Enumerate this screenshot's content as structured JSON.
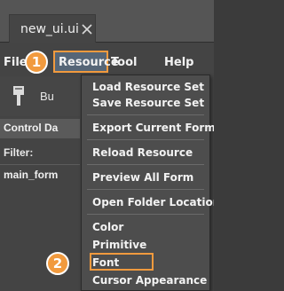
{
  "tab": {
    "title": "new_ui.ui",
    "close_icon": "close-icon"
  },
  "menubar": {
    "file": "File",
    "resource": "Resource",
    "tool": "Tool",
    "help": "Help"
  },
  "toolbar": {
    "label": "Bu",
    "icon": "brush-icon"
  },
  "left_panel": {
    "header": "Control Da",
    "filter": "Filter:",
    "tree_item": "main_form"
  },
  "resource_menu": {
    "items": [
      "Load Resource Set",
      "Save Resource Set",
      "Export Current Form",
      "Reload Resource",
      "Preview All Form",
      "Open Folder Location",
      "Color",
      "Primitive",
      "Font",
      "Cursor Appearance"
    ]
  },
  "callouts": {
    "first": "1",
    "second": "2"
  },
  "colors": {
    "accent": "#f19a3e",
    "menu_bg": "#4d4d4d",
    "app_bg": "#444444"
  }
}
